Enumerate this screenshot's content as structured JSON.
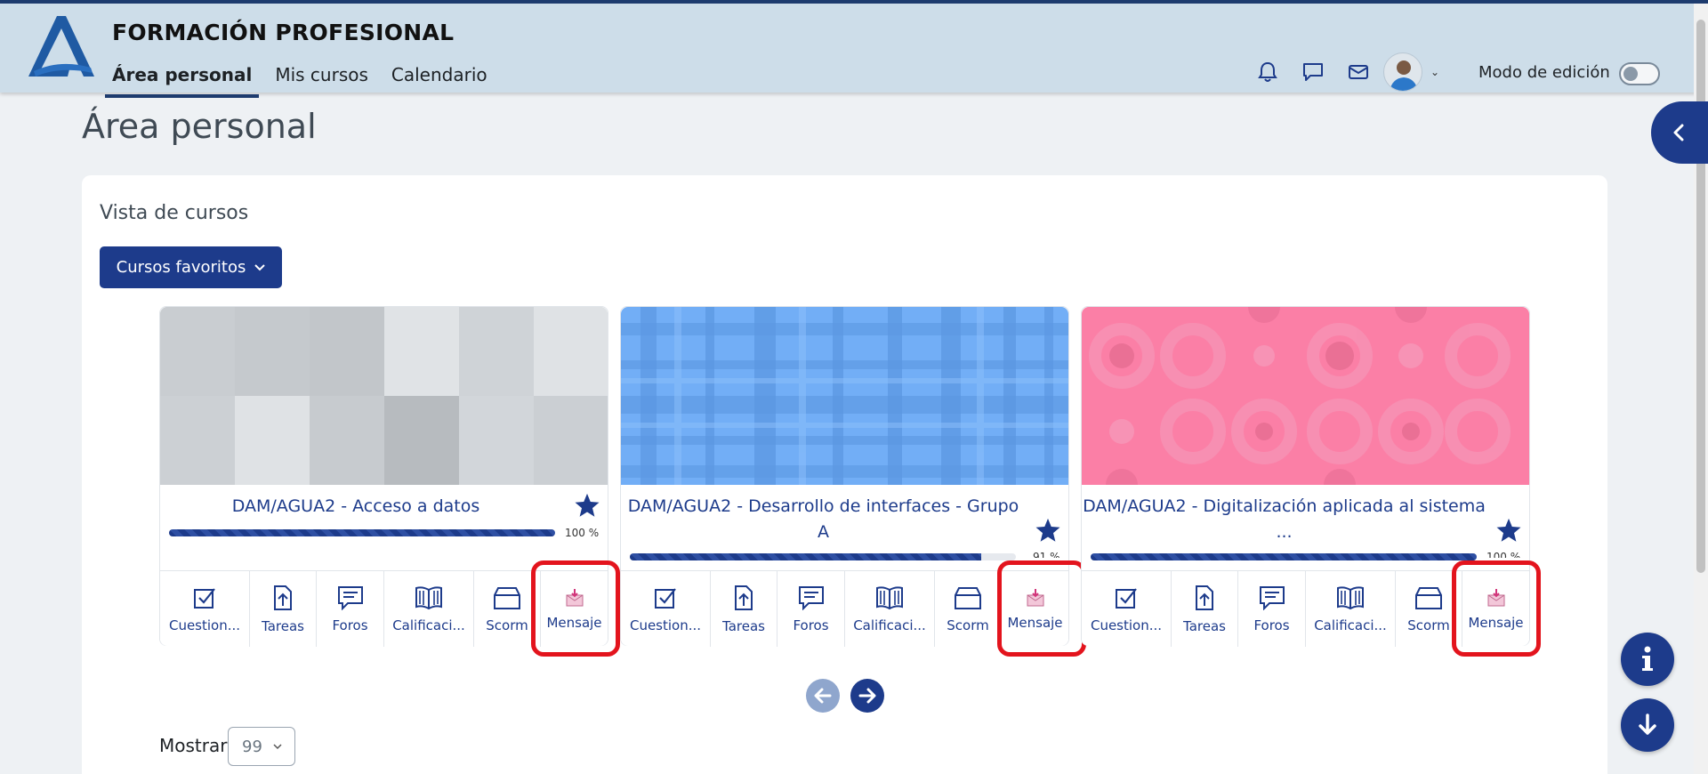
{
  "header": {
    "brand": "FORMACIÓN PROFESIONAL",
    "nav": [
      {
        "label": "Área personal",
        "active": true
      },
      {
        "label": "Mis cursos",
        "active": false
      },
      {
        "label": "Calendario",
        "active": false
      }
    ],
    "icons": [
      "bell-icon",
      "chat-icon",
      "mail-icon"
    ],
    "edit_mode_label": "Modo de edición",
    "edit_mode_on": false
  },
  "page": {
    "title": "Área personal"
  },
  "courses_block": {
    "title": "Vista de cursos",
    "filter_button": "Cursos favoritos",
    "courses": [
      {
        "name": "DAM/AGUA2 - Acceso a datos",
        "progress": 100,
        "progress_label": "100 %",
        "favorite": true,
        "pattern": "grey-squares",
        "actions": [
          "Cuestion...",
          "Tareas",
          "Foros",
          "Calificaci...",
          "Scorm",
          "Mensaje"
        ]
      },
      {
        "name": "DAM/AGUA2 - Desarrollo de interfaces - Grupo A",
        "progress": 91,
        "progress_label": "91 %",
        "favorite": true,
        "pattern": "blue-plaid",
        "actions": [
          "Cuestion...",
          "Tareas",
          "Foros",
          "Calificaci...",
          "Scorm",
          "Mensaje"
        ]
      },
      {
        "name": "DAM/AGUA2 - Digitalización aplicada al sistema ...",
        "progress": 100,
        "progress_label": "100 %",
        "favorite": true,
        "pattern": "pink-circles",
        "actions": [
          "Cuestion...",
          "Tareas",
          "Foros",
          "Calificaci...",
          "Scorm",
          "Mensaje"
        ]
      }
    ],
    "show_label": "Mostrar",
    "show_value": "99"
  },
  "colors": {
    "primary": "#1d3b8b",
    "navbar_bg": "#cddde9",
    "highlight": "#e3141d"
  }
}
